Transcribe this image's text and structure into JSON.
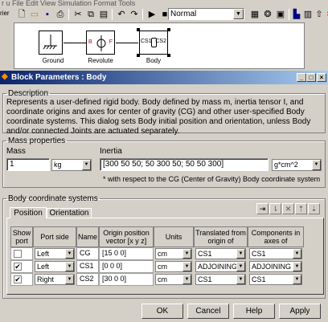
{
  "background_window": {
    "menu_text": "r u  File  Edit  View  Simulation  Format  Tools",
    "left_text": "rier",
    "sim_mode": "Normal",
    "blocks": {
      "ground": "Ground",
      "revolute": "Revolute",
      "revolute_b": "B",
      "revolute_f": "F",
      "body": "Body",
      "body_port_left": "CS1",
      "body_port_right": "CS2"
    }
  },
  "dialog": {
    "title": "Block Parameters : Body",
    "description_legend": "Description",
    "description": "Represents a user-defined rigid body. Body defined by mass m, inertia tensor I, and coordinate origins and axes for center of gravity (CG) and other user-specified Body coordinate systems. This dialog sets Body initial position and orientation, unless Body and/or connected Joints are actuated separately.",
    "mass_props_legend": "Mass properties",
    "mass_label": "Mass",
    "mass_value": "1",
    "mass_unit": "kg",
    "inertia_label": "Inertia",
    "inertia_value": "[300 50 50; 50 300 50; 50 50 300]",
    "inertia_unit": "g*cm^2",
    "inertia_note": "* with respect to the CG (Center of Gravity) Body coordinate system",
    "cs_legend": "Body coordinate systems",
    "tabs": [
      "Position",
      "Orientation"
    ],
    "columns": {
      "show_port": "Show port",
      "port_side": "Port side",
      "name": "Name",
      "origin": "Origin position vector [x y z]",
      "units": "Units",
      "translated": "Translated from origin of",
      "components": "Components in axes of"
    },
    "rows": [
      {
        "checked": false,
        "side": "Left",
        "name": "CG",
        "origin": "[15 0 0]",
        "units": "cm",
        "translated": "CS1",
        "components": "CS1"
      },
      {
        "checked": true,
        "side": "Left",
        "name": "CS1",
        "origin": "[0 0 0]",
        "units": "cm",
        "translated": "ADJOINING",
        "components": "ADJOINING"
      },
      {
        "checked": true,
        "side": "Right",
        "name": "CS2",
        "origin": "[30 0 0]",
        "units": "cm",
        "translated": "CS1",
        "components": "CS1"
      }
    ],
    "buttons": {
      "ok": "OK",
      "cancel": "Cancel",
      "help": "Help",
      "apply": "Apply"
    }
  }
}
